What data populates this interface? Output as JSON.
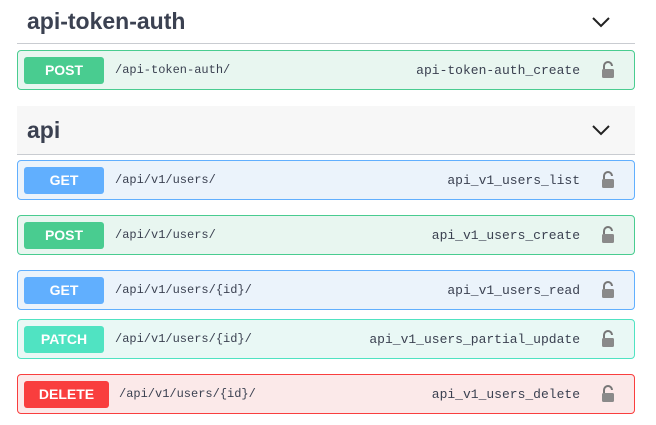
{
  "sections": [
    {
      "title": "api-token-auth",
      "operations": [
        {
          "method": "POST",
          "path": "/api-token-auth/",
          "operation_id": "api-token-auth_create"
        }
      ]
    },
    {
      "title": "api",
      "operations": [
        {
          "method": "GET",
          "path": "/api/v1/users/",
          "operation_id": "api_v1_users_list"
        },
        {
          "method": "POST",
          "path": "/api/v1/users/",
          "operation_id": "api_v1_users_create"
        },
        {
          "method": "GET",
          "path": "/api/v1/users/{id}/",
          "operation_id": "api_v1_users_read"
        },
        {
          "method": "PATCH",
          "path": "/api/v1/users/{id}/",
          "operation_id": "api_v1_users_partial_update"
        },
        {
          "method": "DELETE",
          "path": "/api/v1/users/{id}/",
          "operation_id": "api_v1_users_delete"
        }
      ]
    }
  ],
  "icons": {
    "expand": "chevron-down-icon",
    "auth": "lock-icon"
  },
  "colors": {
    "get": "#61affe",
    "post": "#49cc90",
    "patch": "#50e3c2",
    "delete": "#f93e3e",
    "text": "#3b4151"
  }
}
